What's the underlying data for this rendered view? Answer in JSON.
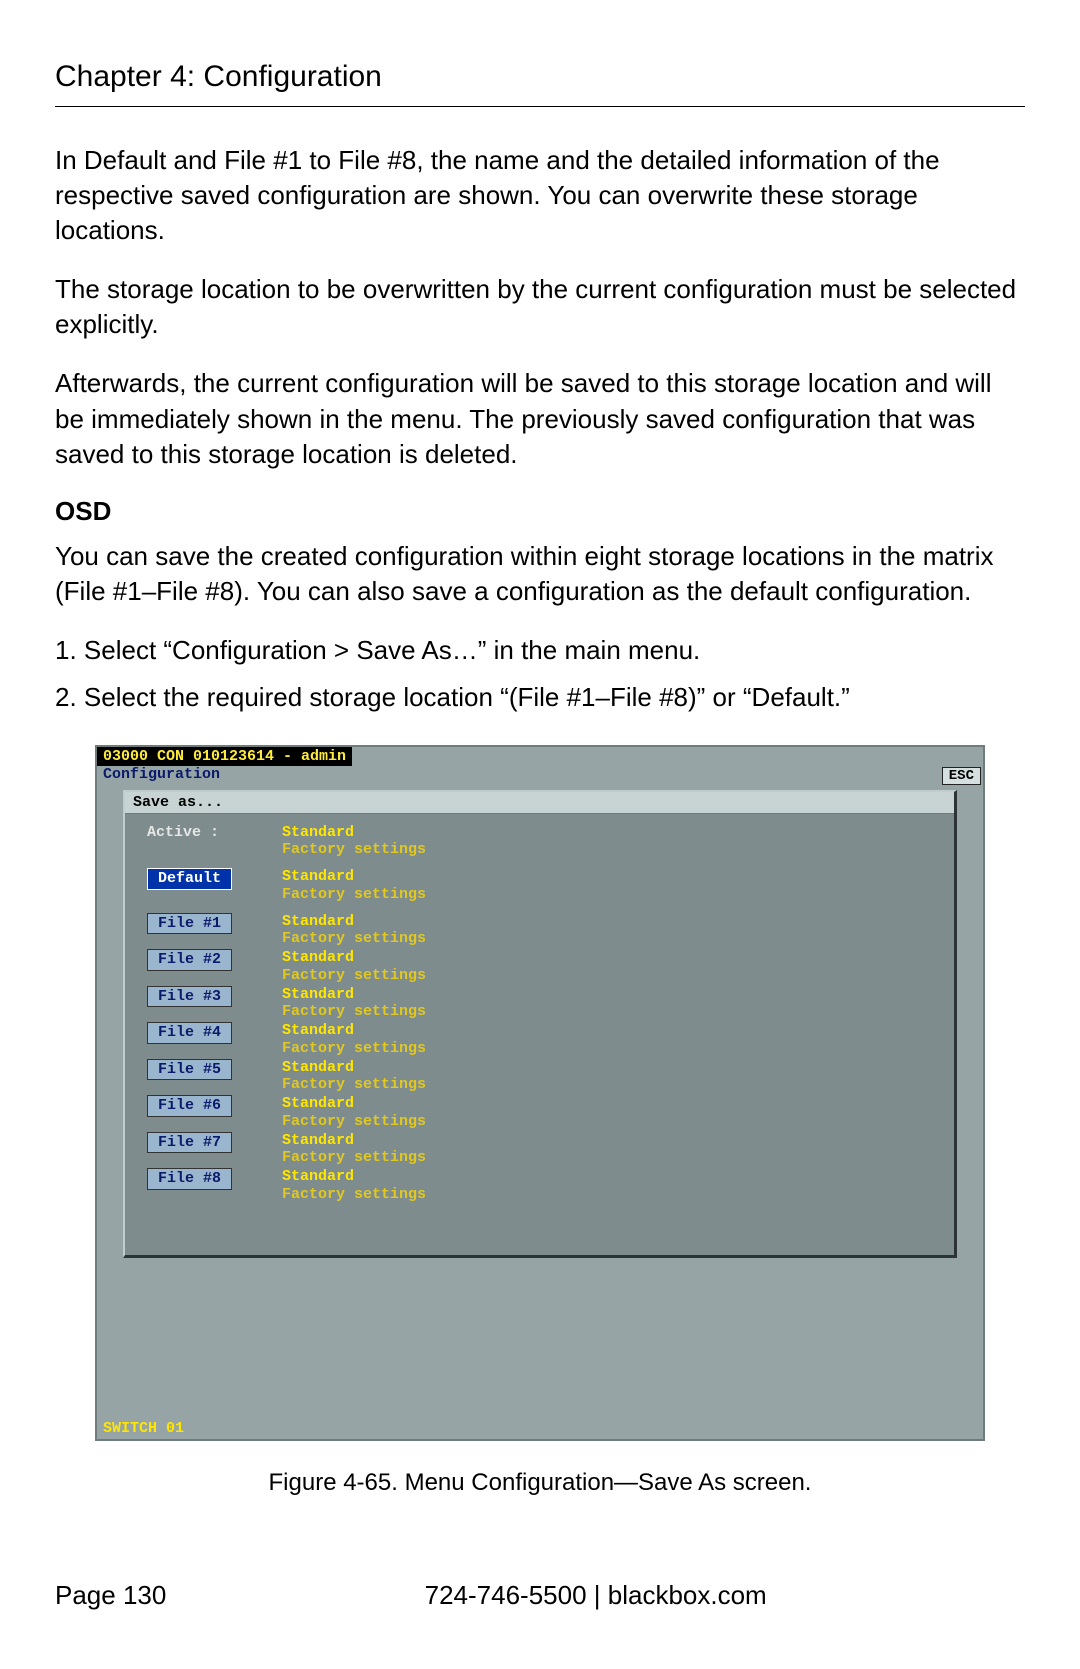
{
  "chapter_title": "Chapter 4: Configuration",
  "paragraphs": {
    "p1": "In Default and File #1 to File #8, the name and the detailed information of the respective saved configuration are shown. You can overwrite these storage locations.",
    "p2": "The storage location to be overwritten by the current configuration must be selected explicitly.",
    "p3": "Afterwards, the current configuration will be saved to this storage location and will be immediately shown in the menu. The previously saved configuration that was saved to this storage location is deleted.",
    "osd_heading": "OSD",
    "p4": "You can save the created configuration within eight storage locations in the matrix (File #1–File #8). You can also save a configuration as the default configuration.",
    "step1": "1. Select “Configuration > Save As…” in the main menu.",
    "step2": "2. Select the required storage location “(File #1–File #8)” or “Default.”"
  },
  "osd": {
    "title": "03000 CON 010123614 - admin",
    "config_label": "Configuration",
    "esc_label": "ESC",
    "saveas_label": "Save as...",
    "active_label": "Active  :",
    "rows": [
      {
        "kind": "active",
        "label": "Active  :",
        "line1": "Standard",
        "line2": "Factory settings"
      },
      {
        "kind": "default",
        "label": "Default",
        "line1": "Standard",
        "line2": "Factory settings"
      },
      {
        "kind": "file",
        "label": "File #1",
        "line1": "Standard",
        "line2": "Factory settings"
      },
      {
        "kind": "file",
        "label": "File #2",
        "line1": "Standard",
        "line2": "Factory settings"
      },
      {
        "kind": "file",
        "label": "File #3",
        "line1": "Standard",
        "line2": "Factory settings"
      },
      {
        "kind": "file",
        "label": "File #4",
        "line1": "Standard",
        "line2": "Factory settings"
      },
      {
        "kind": "file",
        "label": "File #5",
        "line1": "Standard",
        "line2": "Factory settings"
      },
      {
        "kind": "file",
        "label": "File #6",
        "line1": "Standard",
        "line2": "Factory settings"
      },
      {
        "kind": "file",
        "label": "File #7",
        "line1": "Standard",
        "line2": "Factory settings"
      },
      {
        "kind": "file",
        "label": "File #8",
        "line1": "Standard",
        "line2": "Factory settings"
      }
    ],
    "bottom": "SWITCH 01"
  },
  "caption": "Figure 4-65. Menu Configuration—Save As screen.",
  "footer": {
    "page": "Page 130",
    "center": "724-746-5500   |   blackbox.com"
  }
}
